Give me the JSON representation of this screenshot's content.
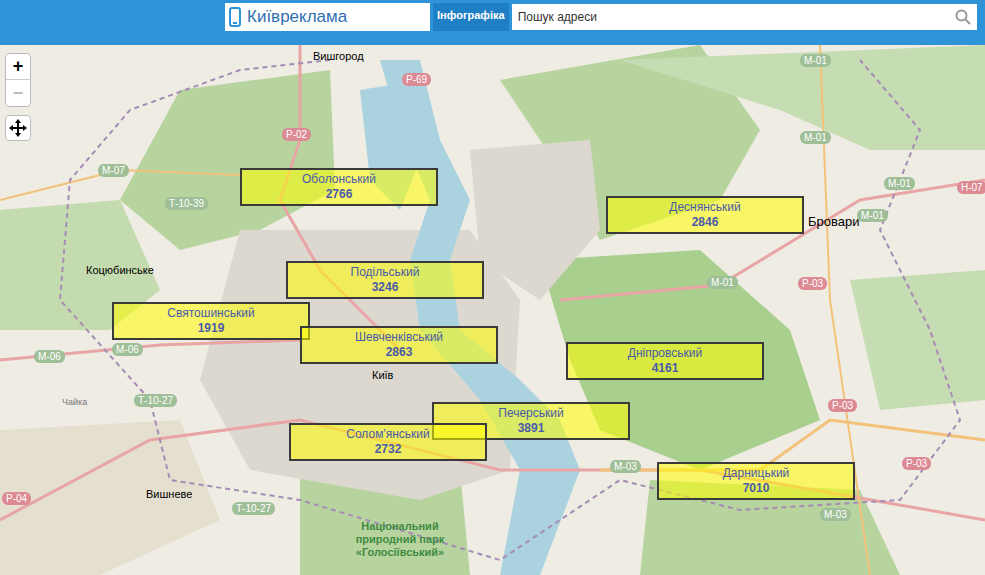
{
  "header": {
    "logo": "Київреклама",
    "tab": {
      "label": "Інфографіка",
      "selected": true
    },
    "search": {
      "placeholder": "Пошук адреси"
    }
  },
  "zoom": {
    "in": "+",
    "out": "−"
  },
  "districts": [
    {
      "name": "Оболонський",
      "count": "2766"
    },
    {
      "name": "Деснянський",
      "count": "2846"
    },
    {
      "name": "Подільський",
      "count": "3246"
    },
    {
      "name": "Святошинський",
      "count": "1919"
    },
    {
      "name": "Шевченківський",
      "count": "2863"
    },
    {
      "name": "Дніпровський",
      "count": "4161"
    },
    {
      "name": "Печерський",
      "count": "3891"
    },
    {
      "name": "Солом'янський",
      "count": "2732"
    },
    {
      "name": "Дарницький",
      "count": "7010"
    }
  ],
  "places": [
    {
      "name": "Вишгород"
    },
    {
      "name": "Бровари"
    },
    {
      "name": "Коцюбинське"
    },
    {
      "name": "Київ"
    },
    {
      "name": "Вишневе"
    },
    {
      "name": "Чайка"
    },
    {
      "name": "Національний природний парк «Голосіївський»"
    }
  ],
  "roads": [
    {
      "label": "Р-69",
      "color": "#dc8a93"
    },
    {
      "label": "Р-02",
      "color": "#dc8a93"
    },
    {
      "label": "М-07",
      "color": "#9fbf98"
    },
    {
      "label": "Т-10-39",
      "color": "#9fbf98"
    },
    {
      "label": "М-01",
      "color": "#9fbf98"
    },
    {
      "label": "М-01",
      "color": "#9fbf98"
    },
    {
      "label": "М-01",
      "color": "#9fbf98"
    },
    {
      "label": "Н-07",
      "color": "#dc8a93"
    },
    {
      "label": "М-01",
      "color": "#9fbf98"
    },
    {
      "label": "М-01",
      "color": "#9fbf98"
    },
    {
      "label": "М-06",
      "color": "#9fbf98"
    },
    {
      "label": "М-06",
      "color": "#9fbf98"
    },
    {
      "label": "Т-10-27",
      "color": "#9fbf98"
    },
    {
      "label": "Р-03",
      "color": "#dc8a93"
    },
    {
      "label": "Р-03",
      "color": "#dc8a93"
    },
    {
      "label": "Р-03",
      "color": "#dc8a93"
    },
    {
      "label": "М-03",
      "color": "#9fbf98"
    },
    {
      "label": "М-03",
      "color": "#9fbf98"
    },
    {
      "label": "Р-04",
      "color": "#dc8a93"
    },
    {
      "label": "Т-10-27",
      "color": "#9fbf98"
    }
  ]
}
